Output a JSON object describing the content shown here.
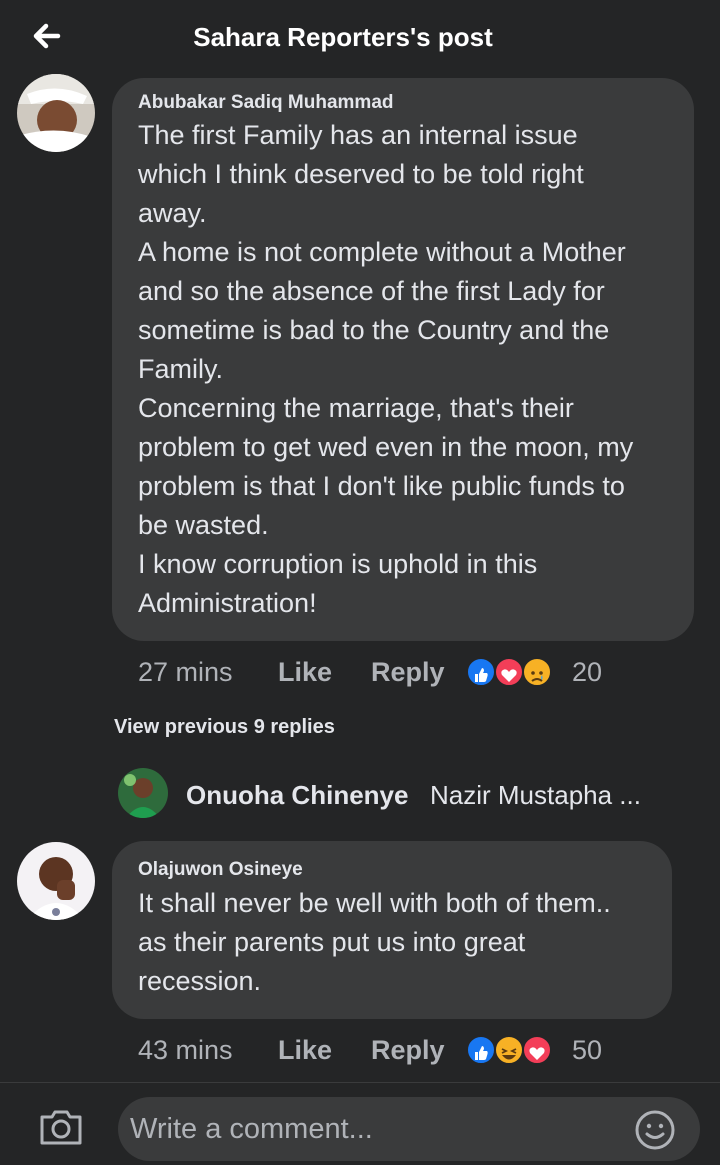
{
  "header": {
    "title": "Sahara Reporters's post",
    "back_icon": "back-arrow-icon"
  },
  "comments": [
    {
      "author": "Abubakar Sadiq Muhammad",
      "text": "The first Family has an internal issue\nwhich I think deserved to be told right\naway.\nA home is not complete without a Mother\nand so the absence of the first Lady for\nsometime is bad to the Country and the\nFamily.\nConcerning the marriage, that's their\nproblem to get wed even in the moon, my\nproblem is that I don't like public funds to\nbe wasted.\nI know corruption is uphold in this\nAdministration!",
      "time": "27 mins",
      "like_label": "Like",
      "reply_label": "Reply",
      "reactions": [
        "like",
        "love",
        "sad"
      ],
      "reaction_count": "20"
    },
    {
      "author": "Olajuwon Osineye",
      "text": "It shall never be well with both of them..\nas their parents put us into great\nrecession.",
      "time": "43 mins",
      "like_label": "Like",
      "reply_label": "Reply",
      "reactions": [
        "like",
        "haha",
        "love"
      ],
      "reaction_count": "50"
    }
  ],
  "view_previous": "View previous 9 replies",
  "reply_preview": {
    "name": "Onuoha Chinenye",
    "snippet": "Nazir Mustapha ..."
  },
  "composer": {
    "placeholder": "Write a comment...",
    "camera_icon": "camera-icon",
    "emoji_icon": "emoji-icon"
  },
  "colors": {
    "background": "#242526",
    "bubble": "#3a3b3c",
    "text": "#e4e6eb",
    "muted": "#b0b3b8",
    "like_blue": "#1877f2",
    "love_red": "#f33e58",
    "emoji_yellow": "#f7b125"
  }
}
